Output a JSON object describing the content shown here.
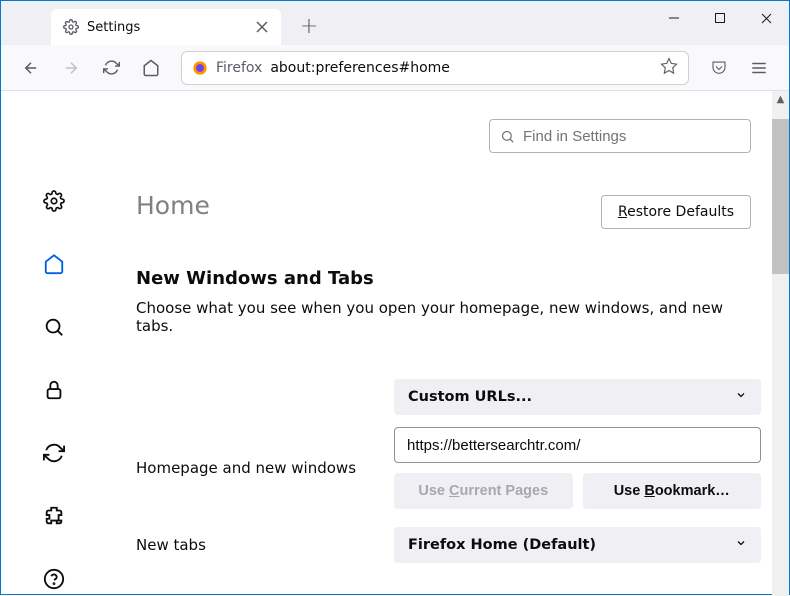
{
  "window": {
    "tab_title": "Settings",
    "url_brand": "Firefox",
    "url": "about:preferences#home"
  },
  "search": {
    "placeholder": "Find in Settings"
  },
  "page": {
    "title": "Home",
    "restore_defaults": "estore Defaults",
    "restore_defaults_key": "R",
    "section_title": "New Windows and Tabs",
    "description": "Choose what you see when you open your homepage, new windows, and new tabs."
  },
  "homepage": {
    "label": "Homepage and new windows",
    "select_value": "Custom URLs...",
    "url_value": "https://bettersearchtr.com/",
    "use_current_pages": "urrent Pages",
    "use_current_prefix": "Use ",
    "use_current_key": "C",
    "use_bookmark": "ookmark…",
    "use_bookmark_prefix": "Use ",
    "use_bookmark_key": "B"
  },
  "newtabs": {
    "label": "New tabs",
    "select_value": "Firefox Home (Default)"
  },
  "sidebar": {
    "items": [
      "general",
      "home",
      "search",
      "privacy",
      "sync",
      "extensions",
      "help"
    ]
  }
}
